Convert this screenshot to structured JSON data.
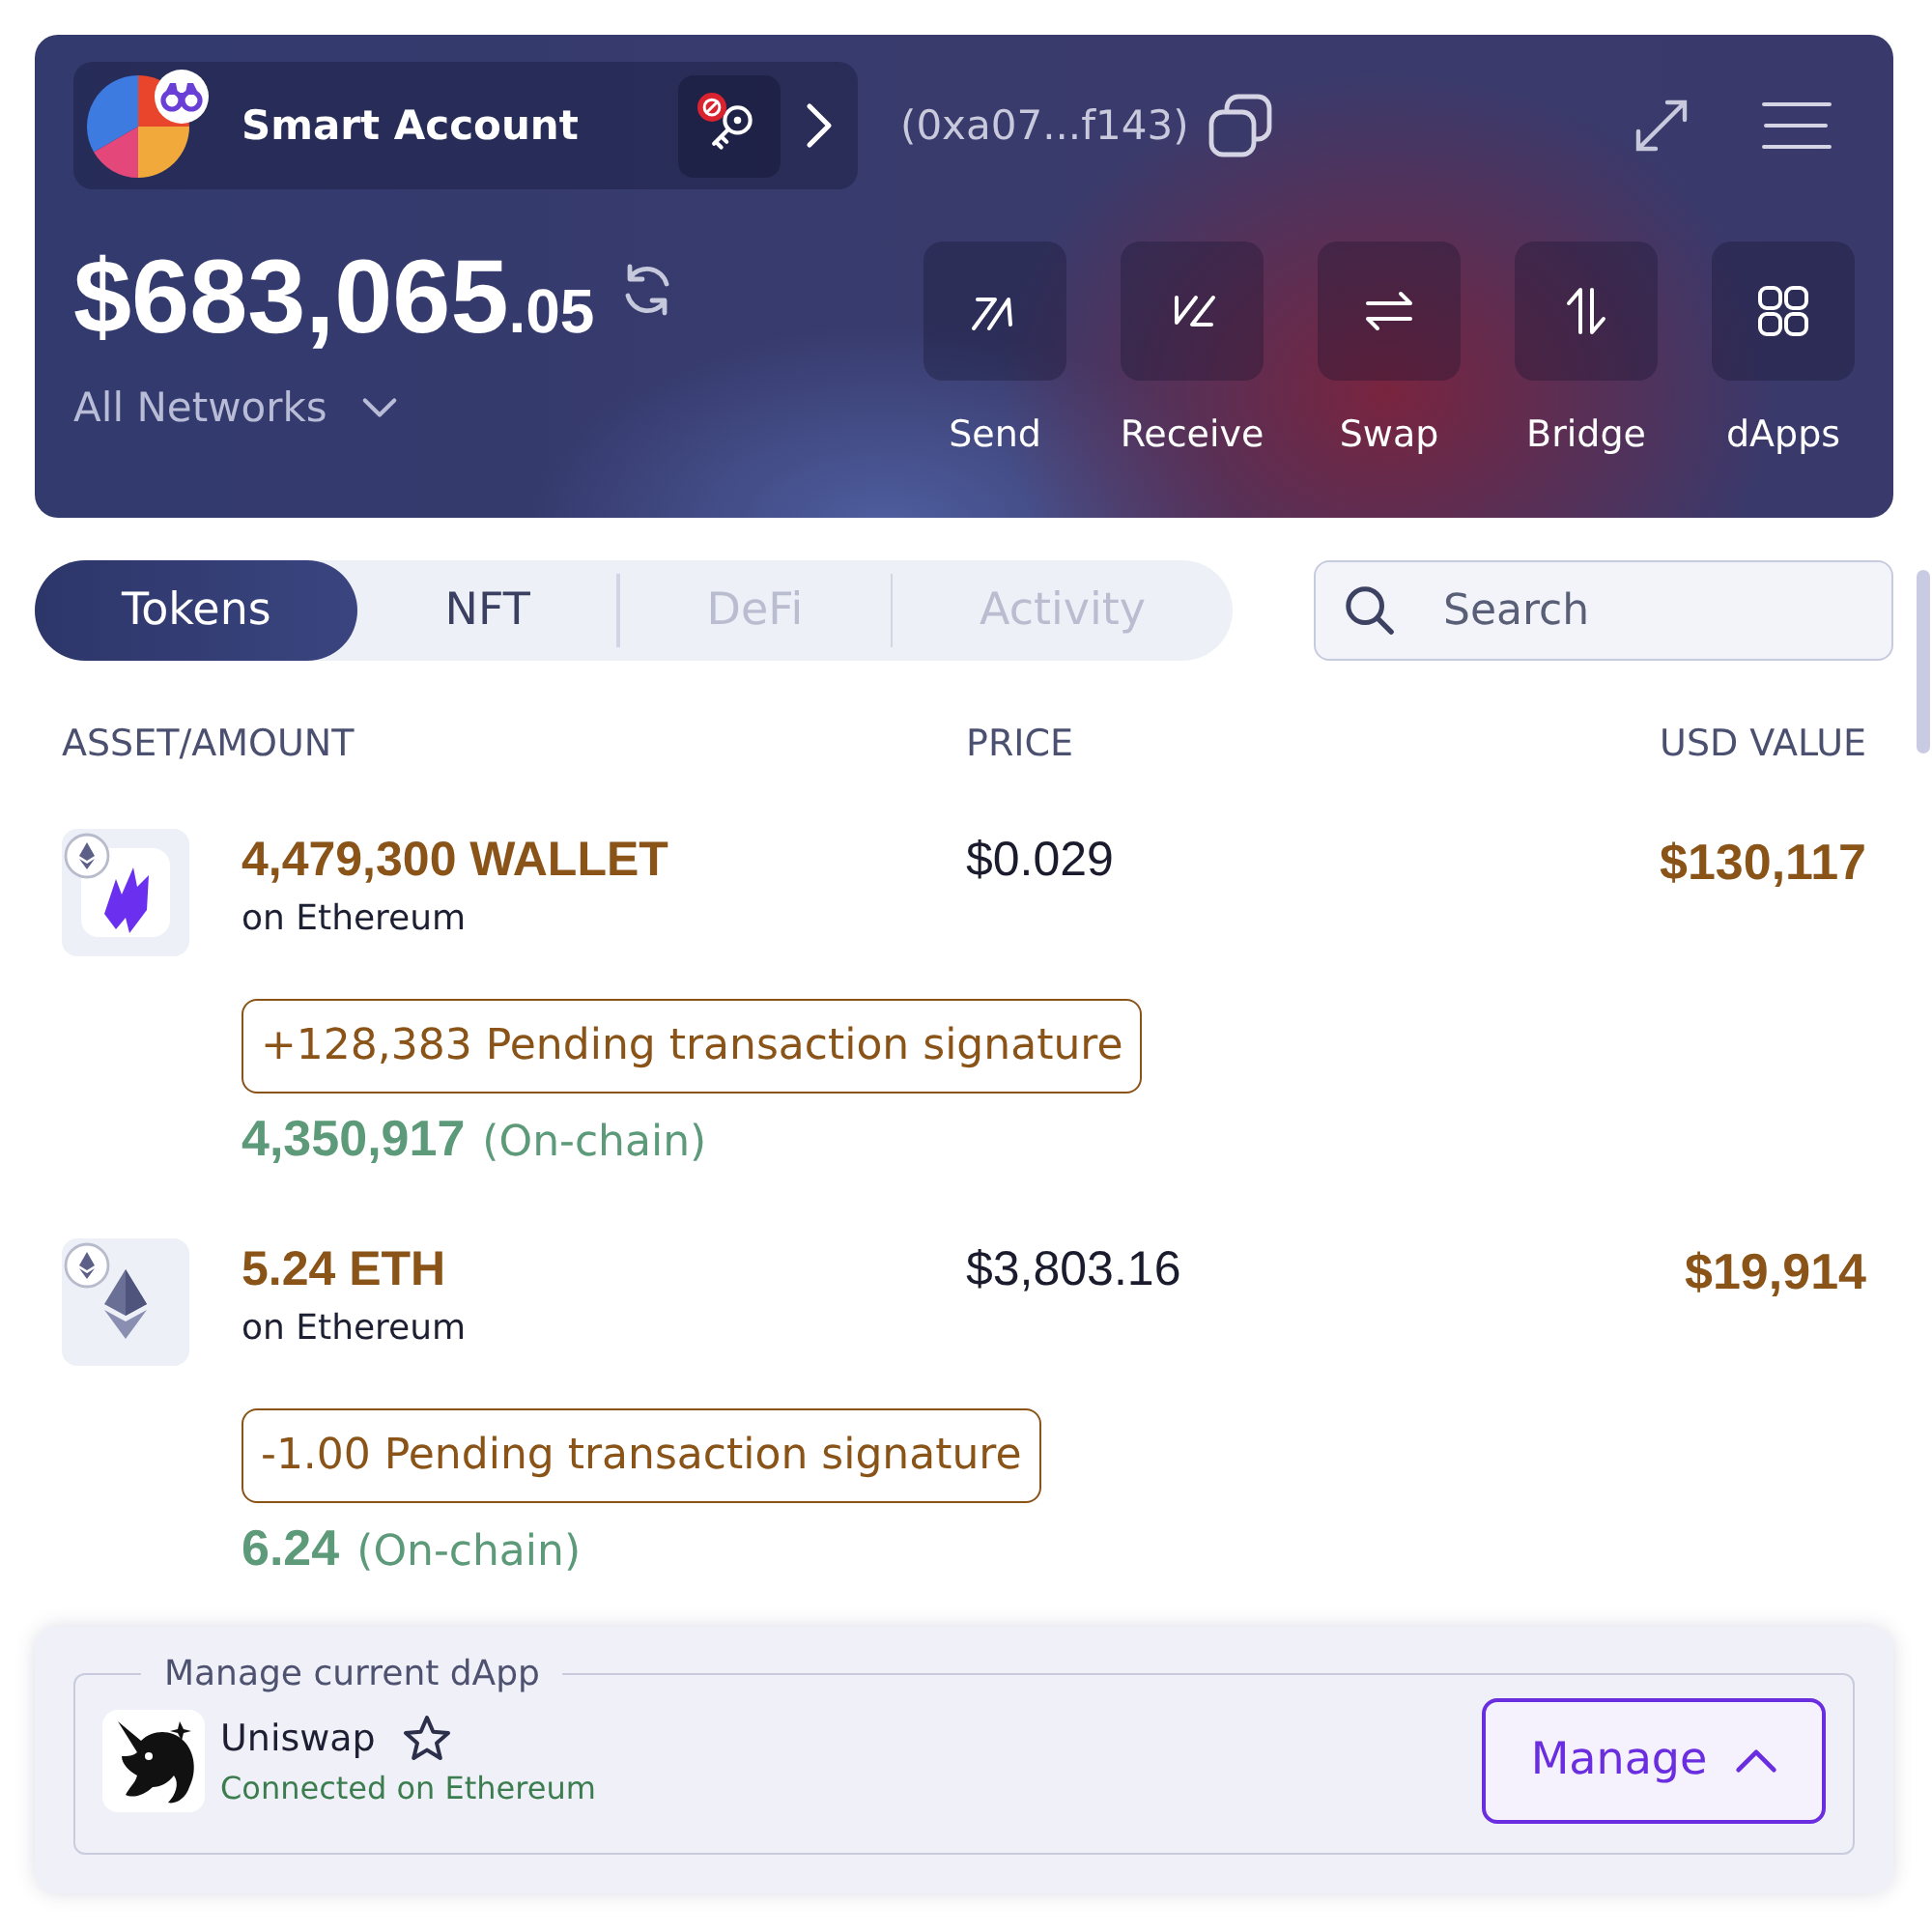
{
  "header": {
    "account": {
      "name": "Smart Account"
    },
    "address": "(0xa07...f143)",
    "balance": {
      "whole": "$683,065",
      "cents": ".05"
    },
    "network": "All Networks",
    "actions": [
      {
        "label": "Send",
        "kind": "send"
      },
      {
        "label": "Receive",
        "kind": "receive"
      },
      {
        "label": "Swap",
        "kind": "swap"
      },
      {
        "label": "Bridge",
        "kind": "bridge"
      },
      {
        "label": "dApps",
        "kind": "dapps"
      }
    ]
  },
  "tabs": [
    {
      "label": "Tokens",
      "selected": true,
      "disabled": false
    },
    {
      "label": "NFT",
      "selected": false,
      "disabled": false
    },
    {
      "label": "DeFi",
      "selected": false,
      "disabled": true
    },
    {
      "label": "Activity",
      "selected": false,
      "disabled": true
    }
  ],
  "search": {
    "placeholder": "Search"
  },
  "table": {
    "columns": [
      "ASSET/AMOUNT",
      "PRICE",
      "USD VALUE"
    ],
    "rows": [
      {
        "kind": "wallet",
        "amount": "4,479,300 WALLET",
        "network": "on Ethereum",
        "price": "$0.029",
        "usd_value": "$130,117",
        "pending": "+128,383 Pending transaction signature",
        "onchain_amount": "4,350,917",
        "onchain_label": "(On-chain)"
      },
      {
        "kind": "eth",
        "amount": "5.24 ETH",
        "network": "on Ethereum",
        "price": "$3,803.16",
        "usd_value": "$19,914",
        "pending": "-1.00 Pending transaction signature",
        "onchain_amount": "6.24",
        "onchain_label": "(On-chain)"
      }
    ]
  },
  "dapp_panel": {
    "legend": "Manage current dApp",
    "name": "Uniswap",
    "favorite": false,
    "status": "Connected on Ethereum",
    "button": "Manage"
  }
}
